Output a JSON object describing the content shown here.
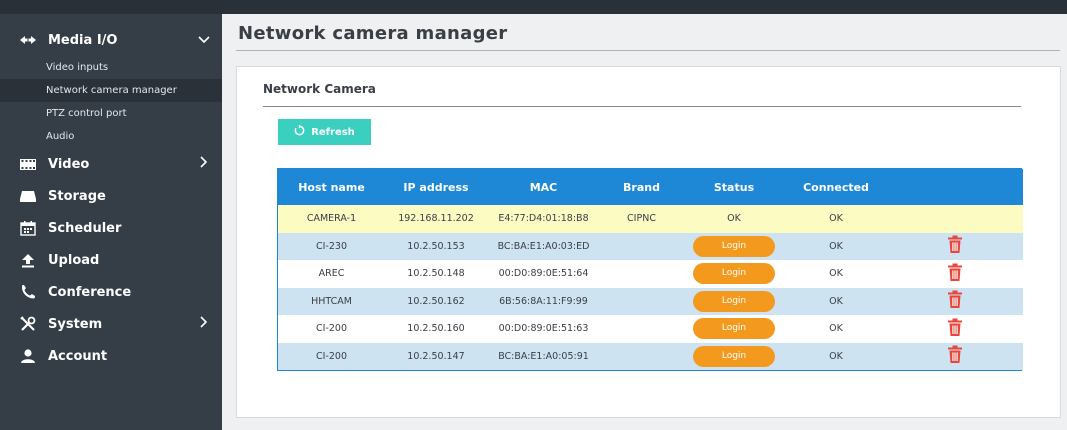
{
  "sidebar": {
    "media_io": {
      "label": "Media I/O",
      "icon": "plug-arrows-icon",
      "expanded": true
    },
    "sub_items": [
      {
        "label": "Video inputs",
        "active": false
      },
      {
        "label": "Network camera manager",
        "active": true
      },
      {
        "label": "PTZ control port",
        "active": false
      },
      {
        "label": "Audio",
        "active": false
      }
    ],
    "items": [
      {
        "label": "Video",
        "icon": "film-icon",
        "has_children": true
      },
      {
        "label": "Storage",
        "icon": "storage-icon",
        "has_children": false
      },
      {
        "label": "Scheduler",
        "icon": "calendar-icon",
        "has_children": false
      },
      {
        "label": "Upload",
        "icon": "upload-icon",
        "has_children": false
      },
      {
        "label": "Conference",
        "icon": "phone-icon",
        "has_children": false
      },
      {
        "label": "System",
        "icon": "tools-icon",
        "has_children": true
      },
      {
        "label": "Account",
        "icon": "user-icon",
        "has_children": false
      }
    ]
  },
  "page": {
    "title": "Network camera manager"
  },
  "card": {
    "title": "Network Camera",
    "refresh_label": "Refresh",
    "columns": [
      "Host name",
      "IP address",
      "MAC",
      "Brand",
      "Status",
      "Connected"
    ],
    "rows": [
      {
        "host": "CAMERA-1",
        "ip": "192.168.11.202",
        "mac": "E4:77:D4:01:18:B8",
        "brand": "CIPNC",
        "status": "OK",
        "connected": "OK",
        "login": false,
        "deletable": false
      },
      {
        "host": "CI-230",
        "ip": "10.2.50.153",
        "mac": "BC:BA:E1:A0:03:ED",
        "brand": "",
        "status": "Login",
        "connected": "OK",
        "login": true,
        "deletable": true
      },
      {
        "host": "AREC",
        "ip": "10.2.50.148",
        "mac": "00:D0:89:0E:51:64",
        "brand": "",
        "status": "Login",
        "connected": "OK",
        "login": true,
        "deletable": true
      },
      {
        "host": "HHTCAM",
        "ip": "10.2.50.162",
        "mac": "6B:56:8A:11:F9:99",
        "brand": "",
        "status": "Login",
        "connected": "OK",
        "login": true,
        "deletable": true
      },
      {
        "host": "CI-200",
        "ip": "10.2.50.160",
        "mac": "00:D0:89:0E:51:63",
        "brand": "",
        "status": "Login",
        "connected": "OK",
        "login": true,
        "deletable": true
      },
      {
        "host": "CI-200",
        "ip": "10.2.50.147",
        "mac": "BC:BA:E1:A0:05:91",
        "brand": "",
        "status": "Login",
        "connected": "OK",
        "login": true,
        "deletable": true
      }
    ]
  },
  "colors": {
    "sidebar_bg": "#353d47",
    "header_blue": "#1e88d6",
    "refresh_teal": "#3bcfc0",
    "login_orange": "#f39a1e",
    "trash_red": "#e8473c",
    "highlight_row": "#fbfbc2",
    "alt_row": "#cee3f1"
  }
}
